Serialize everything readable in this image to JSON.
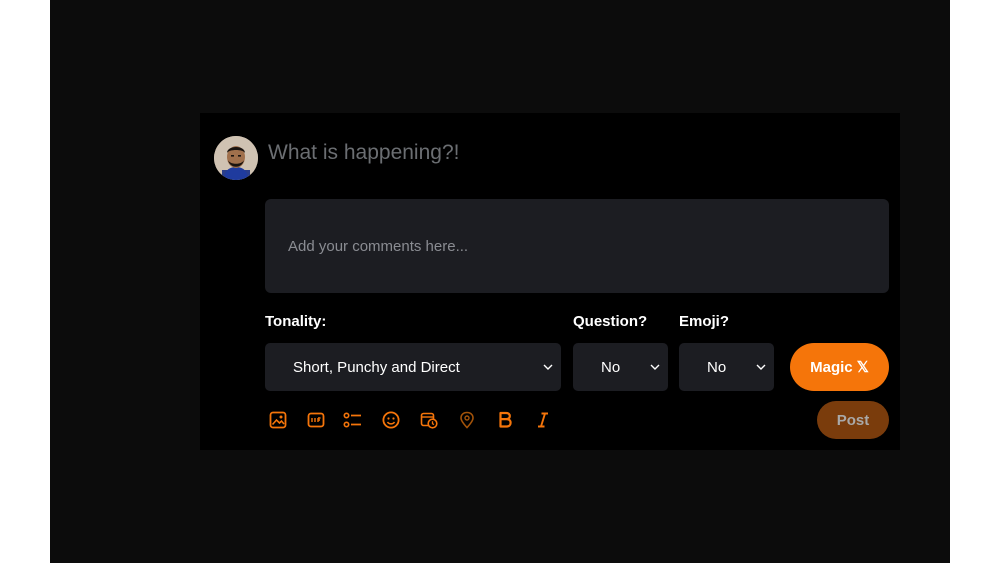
{
  "composer": {
    "prompt": "What is happening?!",
    "comments_placeholder": "Add your comments here...",
    "comments_value": ""
  },
  "options": {
    "tonality": {
      "label": "Tonality:",
      "value": "Short, Punchy and Direct"
    },
    "question": {
      "label": "Question?",
      "value": "No"
    },
    "emoji": {
      "label": "Emoji?",
      "value": "No"
    }
  },
  "actions": {
    "magic_label": "Magic 𝕏",
    "post_label": "Post"
  },
  "toolbar": {
    "icons": [
      "image-icon",
      "gif-icon",
      "poll-icon",
      "emoji-icon",
      "schedule-icon",
      "location-icon",
      "bold-icon",
      "italic-icon"
    ]
  },
  "colors": {
    "accent": "#f5750a",
    "post_disabled": "#7a3c0c",
    "field_bg": "#1c1d22",
    "canvas": "#000000"
  }
}
